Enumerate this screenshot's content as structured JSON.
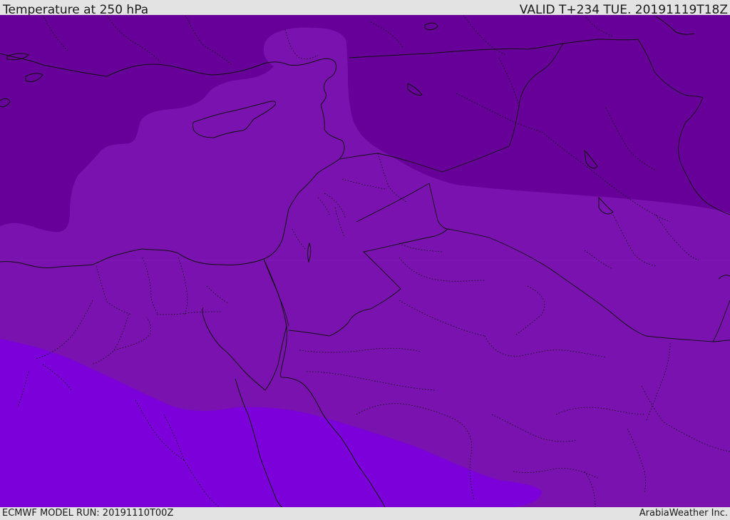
{
  "header": {
    "title": "Temperature at 250 hPa",
    "valid": "VALID T+234 TUE. 20191119T18Z"
  },
  "footer": {
    "model_run": "ECMWF MODEL RUN: 20191110T00Z",
    "credit": "ArabiaWeather Inc."
  },
  "colors": {
    "cold_band": "#670099",
    "mid_band": "#7a12b0",
    "warm_band": "#7b00da",
    "coastline": "#111111",
    "border": "#111111",
    "bar_background": "#e3e3e3"
  },
  "map": {
    "field": "temperature",
    "level": "250 hPa",
    "region": "Eastern Mediterranean / Middle East",
    "band_count": 3
  }
}
